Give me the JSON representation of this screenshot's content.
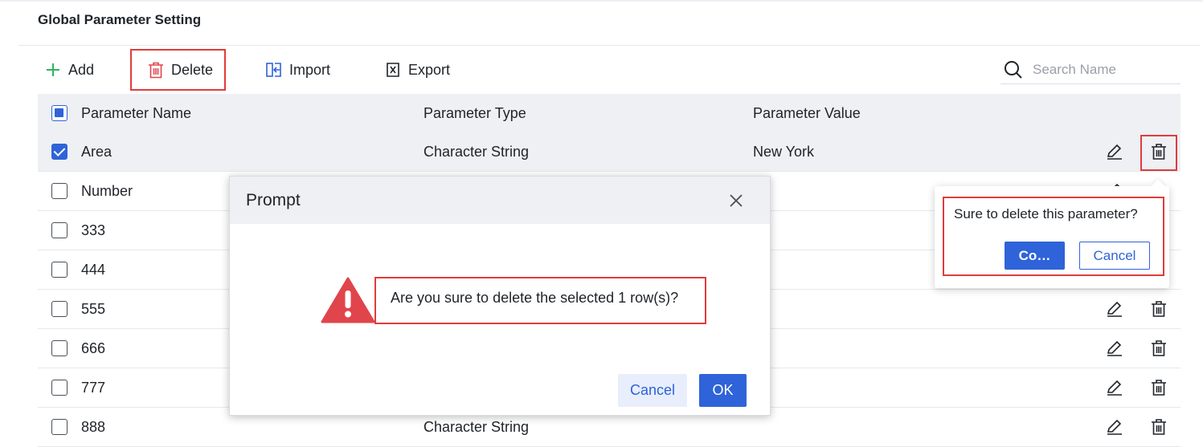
{
  "page": {
    "title": "Global Parameter Setting"
  },
  "toolbar": {
    "add_label": "Add",
    "delete_label": "Delete",
    "import_label": "Import",
    "export_label": "Export",
    "search_placeholder": "Search Name"
  },
  "table": {
    "headers": {
      "name": "Parameter Name",
      "type": "Parameter Type",
      "value": "Parameter Value"
    },
    "rows": [
      {
        "name": "Area",
        "type": "Character String",
        "value": "New York",
        "checked": true
      },
      {
        "name": "Number",
        "type": "",
        "value": "",
        "checked": false
      },
      {
        "name": "333",
        "type": "",
        "value": "",
        "checked": false
      },
      {
        "name": "444",
        "type": "",
        "value": "",
        "checked": false
      },
      {
        "name": "555",
        "type": "",
        "value": "",
        "checked": false
      },
      {
        "name": "666",
        "type": "",
        "value": "",
        "checked": false
      },
      {
        "name": "777",
        "type": "",
        "value": "",
        "checked": false
      },
      {
        "name": "888",
        "type": "Character String",
        "value": "",
        "checked": false
      }
    ]
  },
  "modal": {
    "title": "Prompt",
    "message": "Are you sure to delete the selected 1 row(s)?",
    "cancel_label": "Cancel",
    "ok_label": "OK",
    "icon": "warning-triangle-icon"
  },
  "popover": {
    "message": "Sure to delete this parameter?",
    "confirm_label": "Co…",
    "cancel_label": "Cancel"
  },
  "colors": {
    "accent": "#2f63d9",
    "highlight": "#e23b3b",
    "add_icon": "#2db55d",
    "warning": "#e0454b",
    "header_bg": "#eef0f4"
  }
}
